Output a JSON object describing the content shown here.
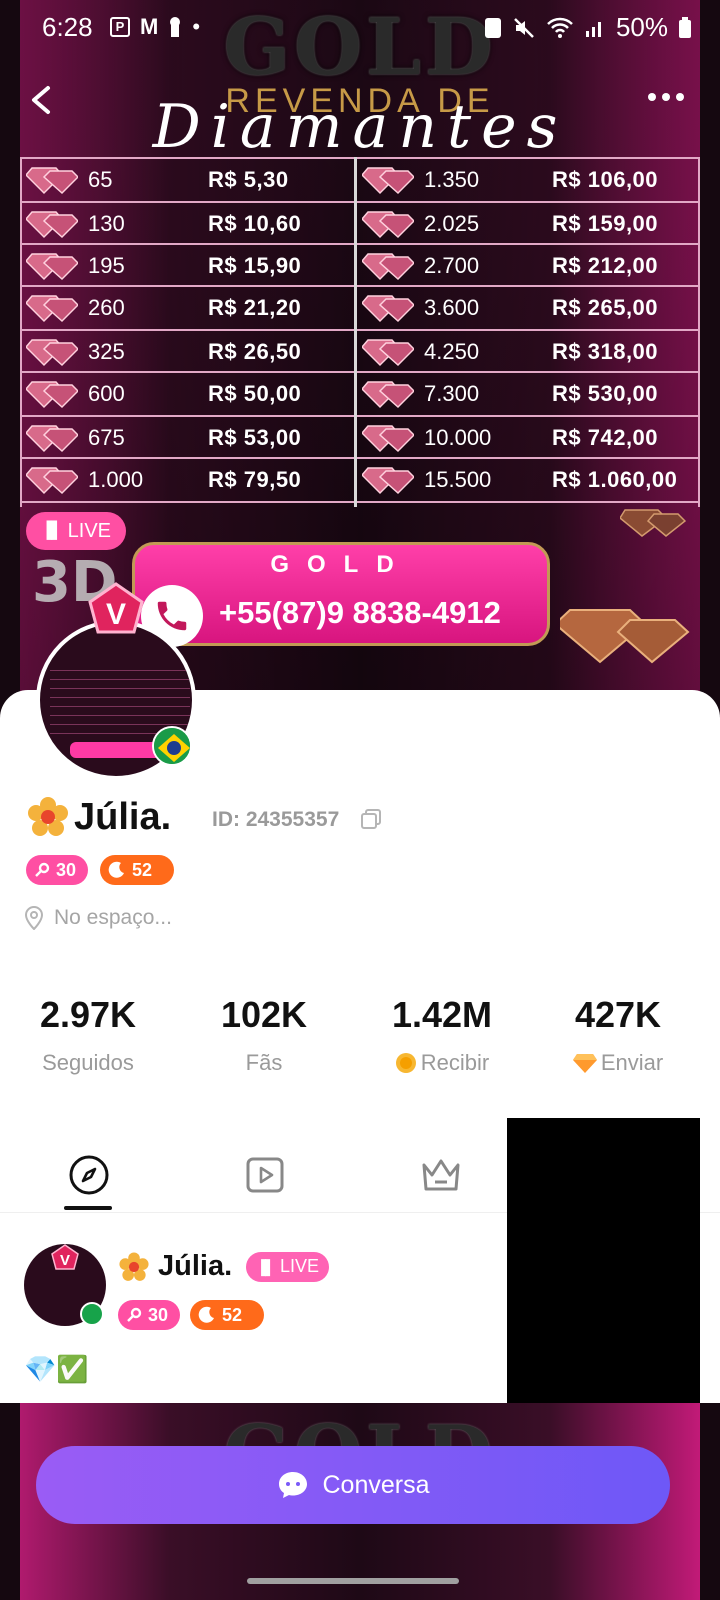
{
  "status_bar": {
    "time": "6:28",
    "battery": "50%",
    "left_glyphs": [
      "P",
      "M",
      "•"
    ]
  },
  "banner": {
    "title": "GOLD",
    "subtitle": "REVENDA DE",
    "script": "Diamantes",
    "price_left": [
      {
        "qty": "65",
        "price": "R$ 5,30"
      },
      {
        "qty": "130",
        "price": "R$ 10,60"
      },
      {
        "qty": "195",
        "price": "R$ 15,90"
      },
      {
        "qty": "260",
        "price": "R$ 21,20"
      },
      {
        "qty": "325",
        "price": "R$ 26,50"
      },
      {
        "qty": "600",
        "price": "R$ 50,00"
      },
      {
        "qty": "675",
        "price": "R$ 53,00"
      },
      {
        "qty": "1.000",
        "price": "R$ 79,50"
      }
    ],
    "price_right": [
      {
        "qty": "1.350",
        "price": "R$ 106,00"
      },
      {
        "qty": "2.025",
        "price": "R$ 159,00"
      },
      {
        "qty": "2.700",
        "price": "R$ 212,00"
      },
      {
        "qty": "3.600",
        "price": "R$ 265,00"
      },
      {
        "qty": "4.250",
        "price": "R$ 318,00"
      },
      {
        "qty": "7.300",
        "price": "R$ 530,00"
      },
      {
        "qty": "10.000",
        "price": "R$ 742,00"
      },
      {
        "qty": "15.500",
        "price": "R$ 1.060,00"
      }
    ],
    "live_label": "LIVE",
    "contact_title": "GOLD",
    "contact_phone": "+55(87)9 8838-4912"
  },
  "profile": {
    "name": "Júlia.",
    "id_text": "ID: 24355357",
    "level_pink": "30",
    "level_orange": "52",
    "location": "No espaço...",
    "stats": [
      {
        "value": "2.97K",
        "label": "Seguidos"
      },
      {
        "value": "102K",
        "label": "Fãs"
      },
      {
        "value": "1.42M",
        "label": "Recibir"
      },
      {
        "value": "427K",
        "label": "Enviar"
      }
    ]
  },
  "post": {
    "name": "Júlia.",
    "live_label": "LIVE",
    "level_pink": "30",
    "level_orange": "52",
    "caption": "💎✅"
  },
  "bottom_banner": {
    "title": "GOLD"
  },
  "chat_button": {
    "label": "Conversa"
  },
  "colors": {
    "pink": "#ff4fa3",
    "orange": "#ff6a1a",
    "button_purple": "#7a5af8"
  }
}
